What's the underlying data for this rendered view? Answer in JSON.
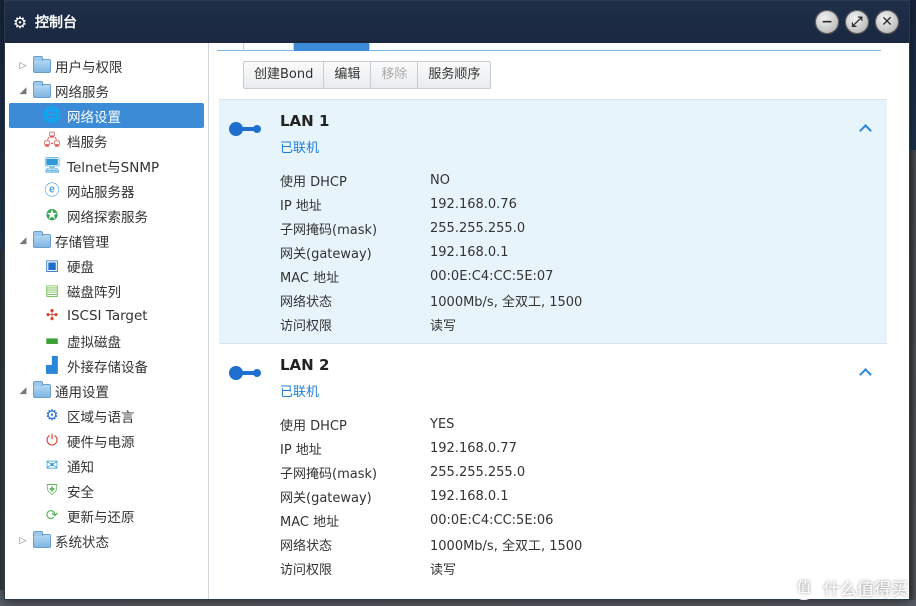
{
  "window": {
    "title": "控制台"
  },
  "title_controls": {
    "minimize": "−",
    "maximize": "⤢",
    "close": "✕"
  },
  "sidebar": {
    "groups": [
      {
        "label": "用户与权限",
        "expanded": false,
        "items": []
      },
      {
        "label": "网络服务",
        "expanded": true,
        "items": [
          {
            "label": "网络设置",
            "icon": "globe-icon",
            "selected": true
          },
          {
            "label": "档服务",
            "icon": "file-service-icon"
          },
          {
            "label": "Telnet与SNMP",
            "icon": "terminal-icon"
          },
          {
            "label": "网站服务器",
            "icon": "web-icon"
          },
          {
            "label": "网络探索服务",
            "icon": "discovery-icon"
          }
        ]
      },
      {
        "label": "存储管理",
        "expanded": true,
        "items": [
          {
            "label": "硬盘",
            "icon": "disk-icon"
          },
          {
            "label": "磁盘阵列",
            "icon": "raid-icon"
          },
          {
            "label": "ISCSI Target",
            "icon": "iscsi-icon"
          },
          {
            "label": "虚拟磁盘",
            "icon": "virtual-disk-icon"
          },
          {
            "label": "外接存储设备",
            "icon": "external-storage-icon"
          }
        ]
      },
      {
        "label": "通用设置",
        "expanded": true,
        "items": [
          {
            "label": "区域与语言",
            "icon": "gear-icon"
          },
          {
            "label": "硬件与电源",
            "icon": "power-icon"
          },
          {
            "label": "通知",
            "icon": "notification-icon"
          },
          {
            "label": "安全",
            "icon": "security-icon"
          },
          {
            "label": "更新与还原",
            "icon": "update-icon"
          }
        ]
      },
      {
        "label": "系统状态",
        "expanded": false,
        "items": []
      }
    ]
  },
  "toolbar": {
    "create_bond": "创建Bond",
    "edit": "编辑",
    "remove": "移除",
    "service_order": "服务顺序"
  },
  "lans": [
    {
      "name": "LAN 1",
      "status": "已联机",
      "fields": [
        {
          "key": "使用 DHCP",
          "value": "NO"
        },
        {
          "key": "IP 地址",
          "value": "192.168.0.76"
        },
        {
          "key": "子网掩码(mask)",
          "value": "255.255.255.0"
        },
        {
          "key": "网关(gateway)",
          "value": "192.168.0.1"
        },
        {
          "key": "MAC 地址",
          "value": "00:0E:C4:CC:5E:07"
        },
        {
          "key": "网络状态",
          "value": "1000Mb/s, 全双工, 1500"
        },
        {
          "key": "访问权限",
          "value": "读写"
        }
      ]
    },
    {
      "name": "LAN 2",
      "status": "已联机",
      "fields": [
        {
          "key": "使用 DHCP",
          "value": "YES"
        },
        {
          "key": "IP 地址",
          "value": "192.168.0.77"
        },
        {
          "key": "子网掩码(mask)",
          "value": "255.255.255.0"
        },
        {
          "key": "网关(gateway)",
          "value": "192.168.0.1"
        },
        {
          "key": "MAC 地址",
          "value": "00:0E:C4:CC:5E:06"
        },
        {
          "key": "网络状态",
          "value": "1000Mb/s, 全双工, 1500"
        },
        {
          "key": "访问权限",
          "value": "读写"
        }
      ]
    }
  ],
  "watermark": {
    "text": "什么值得买",
    "icon": "smzdm-logo-icon"
  },
  "colors": {
    "accent": "#3b8bd6",
    "status_link": "#1f7fd6",
    "lan_icon": "#1f6fcf",
    "titlebar": "#1f2f49"
  }
}
